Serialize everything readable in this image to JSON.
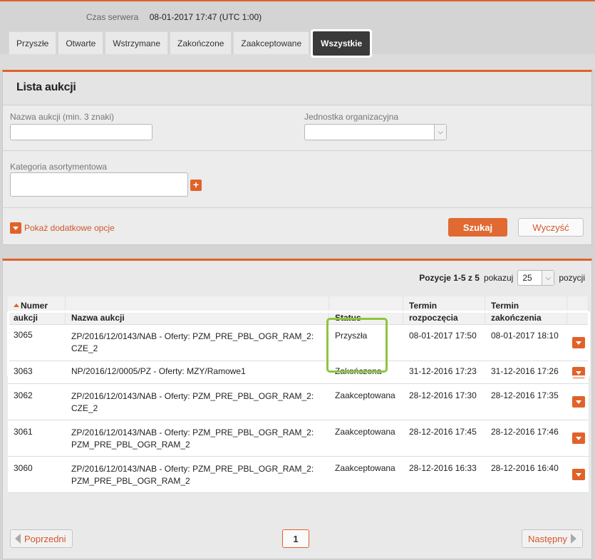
{
  "server": {
    "label": "Czas serwera",
    "value": "08-01-2017 17:47 (UTC 1:00)"
  },
  "tabs": [
    {
      "label": "Przyszłe"
    },
    {
      "label": "Otwarte"
    },
    {
      "label": "Wstrzymane"
    },
    {
      "label": "Zakończone"
    },
    {
      "label": "Zaakceptowane"
    },
    {
      "label": "Wszystkie",
      "active": true
    }
  ],
  "search": {
    "title": "Lista aukcji",
    "name_label": "Nazwa aukcji (min. 3 znaki)",
    "name_value": "",
    "unit_label": "Jednostka organizacyjna",
    "unit_value": "",
    "category_label": "Kategoria asortymentowa",
    "category_value": "",
    "more_options": "Pokaż dodatkowe opcje",
    "search_button": "Szukaj",
    "clear_button": "Wyczyść"
  },
  "results": {
    "positions": "Pozycje 1-5 z 5",
    "show_label": "pokazuj",
    "page_size": "25",
    "items_label": "pozycji",
    "columns": [
      "Numer aukcji",
      "Nazwa aukcji",
      "Status",
      "Termin rozpoczęcia",
      "Termin zakończenia"
    ],
    "col_numer": [
      "Numer",
      "aukcji"
    ],
    "col_start": [
      "Termin",
      "rozpoczęcia"
    ],
    "col_end": [
      "Termin",
      "zakończenia"
    ],
    "rows": [
      {
        "id": "3065",
        "name1": "ZP/2016/12/0143/NAB - Oferty: PZM_PRE_PBL_OGR_RAM_2:",
        "name2": "CZE_2",
        "status": "Przyszła",
        "start": "08-01-2017 17:50",
        "end": "08-01-2017 18:10"
      },
      {
        "id": "3063",
        "name1": "NP/2016/12/0005/PZ - Oferty: MZY/Ramowe1",
        "name2": "",
        "status": "Zakończona",
        "start": "31-12-2016 17:23",
        "end": "31-12-2016 17:26"
      },
      {
        "id": "3062",
        "name1": "ZP/2016/12/0143/NAB - Oferty: PZM_PRE_PBL_OGR_RAM_2:",
        "name2": "CZE_2",
        "status": "Zaakceptowana",
        "start": "28-12-2016 17:30",
        "end": "28-12-2016 17:35"
      },
      {
        "id": "3061",
        "name1": "ZP/2016/12/0143/NAB - Oferty: PZM_PRE_PBL_OGR_RAM_2:",
        "name2": "PZM_PRE_PBL_OGR_RAM_2",
        "status": "Zaakceptowana",
        "start": "28-12-2016 17:45",
        "end": "28-12-2016 17:46"
      },
      {
        "id": "3060",
        "name1": "ZP/2016/12/0143/NAB - Oferty: PZM_PRE_PBL_OGR_RAM_2:",
        "name2": "PZM_PRE_PBL_OGR_RAM_2",
        "status": "Zaakceptowana",
        "start": "28-12-2016 16:33",
        "end": "28-12-2016 16:40"
      }
    ]
  },
  "pagination": {
    "prev": "Poprzedni",
    "page": "1",
    "next": "Następny"
  }
}
